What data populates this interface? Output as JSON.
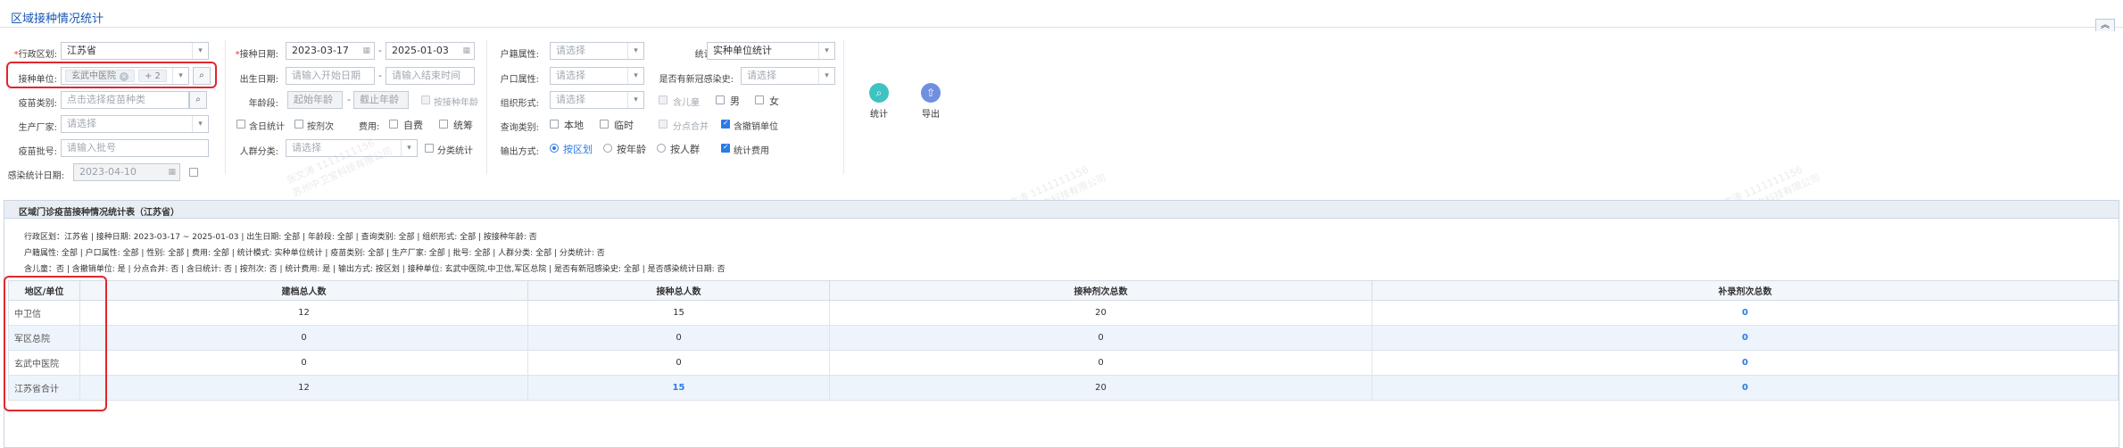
{
  "page_title": "区域接种情况统计",
  "filters": {
    "region": {
      "label": "行政区划:",
      "value": "江苏省"
    },
    "unit": {
      "label": "接种单位:",
      "tag": "玄武中医院",
      "more": "+ 2"
    },
    "vaccine_type": {
      "label": "疫苗类别:",
      "placeholder": "点击选择疫苗种类"
    },
    "manufacturer": {
      "label": "生产厂家:",
      "placeholder": "请选择"
    },
    "batch": {
      "label": "疫苗批号:",
      "placeholder": "请输入批号"
    },
    "infection_date": {
      "label": "感染统计日期:",
      "value": "2023-04-10"
    },
    "vacc_date": {
      "label": "接种日期:",
      "start": "2023-03-17",
      "end": "2025-01-03"
    },
    "birth_date": {
      "label": "出生日期:",
      "start_placeholder": "请输入开始日期",
      "end_placeholder": "请输入结束时间"
    },
    "age": {
      "label": "年龄段:",
      "start_placeholder": "起始年龄",
      "end_placeholder": "截止年龄",
      "by_age": "按接种年龄"
    },
    "by_day": "含日统计",
    "by_dose": "按剂次",
    "fee": {
      "label": "费用:",
      "self": "自费",
      "plan": "统筹"
    },
    "crowd": {
      "label": "人群分类:",
      "placeholder": "请选择",
      "classify": "分类统计"
    },
    "household_attr": {
      "label": "户籍属性:",
      "placeholder": "请选择"
    },
    "household_type": {
      "label": "户口属性:",
      "placeholder": "请选择"
    },
    "org_form": {
      "label": "组织形式:",
      "placeholder": "请选择"
    },
    "query_type": {
      "label": "查询类别:",
      "local": "本地",
      "temp": "临时"
    },
    "output": {
      "label": "输出方式:",
      "by_region": "按区划",
      "by_age": "按年龄",
      "by_crowd": "按人群"
    },
    "stat_mode": {
      "label": "统计模式:",
      "value": "实种单位统计"
    },
    "covid_history": {
      "label": "是否有新冠感染史:",
      "placeholder": "请选择"
    },
    "child": "含儿童",
    "male": "男",
    "female": "女",
    "split_merge": "分点合并",
    "include_cancelled": "含撤销单位",
    "stat_fee": "统计费用"
  },
  "actions": {
    "stat": "统计",
    "export": "导出"
  },
  "report": {
    "title": "区域门诊疫苗接种情况统计表（江苏省）",
    "criteria": [
      "行政区划：江苏省    |    接种日期: 2023-03-17 ~ 2025-01-03    |    出生日期: 全部    |    年龄段: 全部    |    查询类别: 全部    |    组织形式: 全部    |    按接种年龄: 否",
      "户籍属性: 全部    |    户口属性: 全部    |    性别: 全部    |    费用: 全部    |    统计模式: 实种单位统计    |    疫苗类别: 全部    |    生产厂家: 全部    |    批号: 全部    |    人群分类: 全部    |    分类统计: 否",
      "含儿童：否    |    含撤销单位: 是    |    分点合并: 否    |    含日统计: 否    |    按剂次: 否    |    统计费用: 是    |    输出方式: 按区划    |    接种单位: 玄武中医院,中卫信,军区总院    |    是否有新冠感染史: 全部    |    是否感染统计日期: 否"
    ],
    "columns": [
      "地区/单位",
      "建档总人数",
      "接种总人数",
      "接种剂次总数",
      "补录剂次总数"
    ],
    "rows": [
      {
        "name": "中卫信",
        "files": "12",
        "vaccinated": "15",
        "doses": "20",
        "supplement": "0"
      },
      {
        "name": "军区总院",
        "files": "0",
        "vaccinated": "0",
        "doses": "0",
        "supplement": "0"
      },
      {
        "name": "玄武中医院",
        "files": "0",
        "vaccinated": "0",
        "doses": "0",
        "supplement": "0"
      },
      {
        "name": "江苏省合计",
        "files": "12",
        "vaccinated": "15",
        "doses": "20",
        "supplement": "0"
      }
    ]
  },
  "watermark_lines": [
    "张文涛 1111111156",
    "苏州中卫宝科技有限公司"
  ],
  "colors": {
    "accent": "#2d7be5",
    "highlight": "#e0262e",
    "title": "#1a57b3"
  }
}
